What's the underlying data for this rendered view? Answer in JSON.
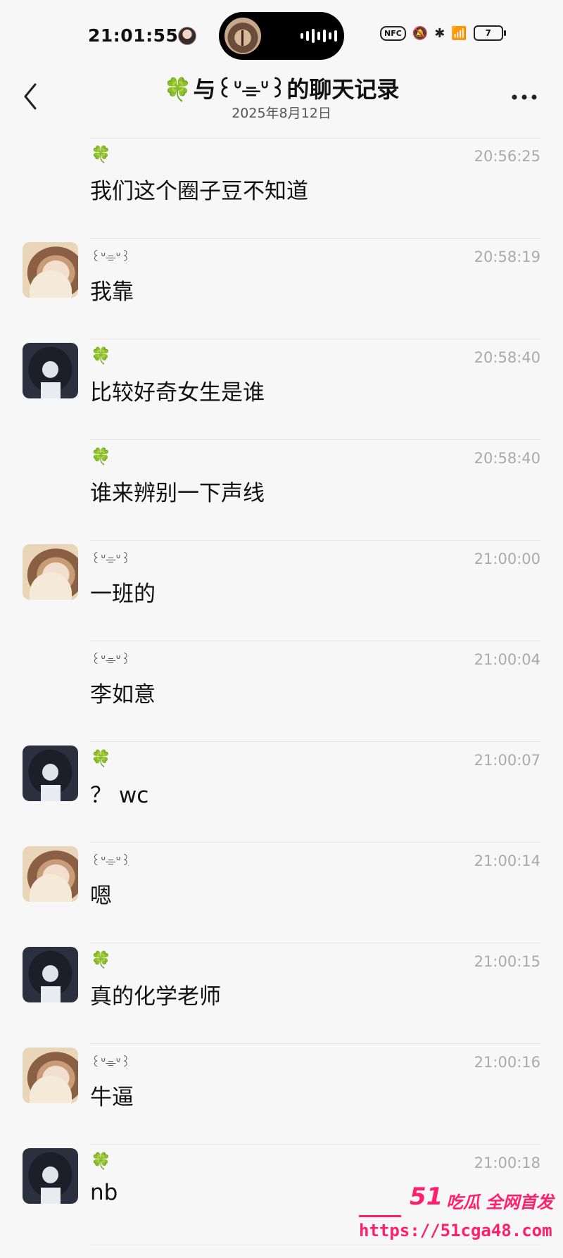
{
  "status_bar": {
    "time": "21:01:55",
    "nfc_label": "NFC",
    "battery": "7"
  },
  "header": {
    "back_icon": "chevron-left-icon",
    "title_clover": "🍀",
    "title": "与꒰ᐡ⌯ᐡ꒱的聊天记录",
    "date": "2025年8月12日",
    "more_icon": "more-horizontal-icon"
  },
  "messages": [
    {
      "sender": "🍀",
      "sender_type": "clover",
      "avatar": "none",
      "time": "20:56:25",
      "text": "我们这个圈子豆不知道"
    },
    {
      "sender": "꒰ᐡ⌯ᐡ꒱",
      "sender_type": "cat",
      "avatar": "girl",
      "time": "20:58:19",
      "text": "我靠"
    },
    {
      "sender": "🍀",
      "sender_type": "clover",
      "avatar": "boy",
      "time": "20:58:40",
      "text": "比较好奇女生是谁"
    },
    {
      "sender": "🍀",
      "sender_type": "clover",
      "avatar": "none",
      "time": "20:58:40",
      "text": "谁来辨别一下声线"
    },
    {
      "sender": "꒰ᐡ⌯ᐡ꒱",
      "sender_type": "cat",
      "avatar": "girl",
      "time": "21:00:00",
      "text": "一班的"
    },
    {
      "sender": "꒰ᐡ⌯ᐡ꒱",
      "sender_type": "cat",
      "avatar": "none",
      "time": "21:00:04",
      "text": "李如意"
    },
    {
      "sender": "🍀",
      "sender_type": "clover",
      "avatar": "boy",
      "time": "21:00:07",
      "text": "？ wc"
    },
    {
      "sender": "꒰ᐡ⌯ᐡ꒱",
      "sender_type": "cat",
      "avatar": "girl",
      "time": "21:00:14",
      "text": "嗯"
    },
    {
      "sender": "🍀",
      "sender_type": "clover",
      "avatar": "boy",
      "time": "21:00:15",
      "text": "真的化学老师"
    },
    {
      "sender": "꒰ᐡ⌯ᐡ꒱",
      "sender_type": "cat",
      "avatar": "girl",
      "time": "21:00:16",
      "text": "牛逼"
    },
    {
      "sender": "🍀",
      "sender_type": "clover",
      "avatar": "boy",
      "time": "21:00:18",
      "text": "nb"
    }
  ],
  "watermark": {
    "logo": "51",
    "brand": "吃瓜 全网首发",
    "url": "https://51cga48.com"
  },
  "colors": {
    "clover_green": "#2fb24b",
    "watermark_pink": "#ff1f6b",
    "background": "#f7f7f7"
  }
}
